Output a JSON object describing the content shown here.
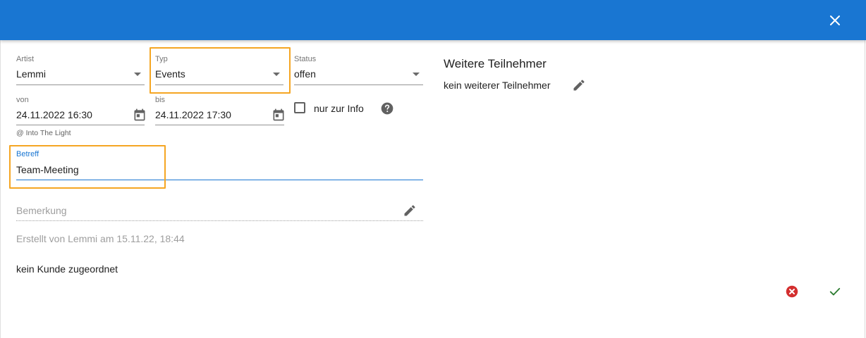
{
  "form": {
    "artist": {
      "label": "Artist",
      "value": "Lemmi"
    },
    "typ": {
      "label": "Typ",
      "value": "Events"
    },
    "status": {
      "label": "Status",
      "value": "offen"
    },
    "von": {
      "label": "von",
      "value": "24.11.2022 16:30"
    },
    "bis": {
      "label": "bis",
      "value": "24.11.2022 17:30"
    },
    "location_hint": "@ Into The Light",
    "info_checkbox": {
      "label": "nur zur Info",
      "checked": false
    },
    "betreff": {
      "label": "Betreff",
      "value": "Team-Meeting"
    },
    "bemerkung": {
      "placeholder": "Bemerkung"
    },
    "created_text": "Erstellt von Lemmi am 15.11.22, 18:44",
    "kunde_text": "kein Kunde zugeordnet"
  },
  "participants": {
    "title": "Weitere Teilnehmer",
    "empty_text": "kein weiterer Teilnehmer"
  },
  "colors": {
    "header": "#1976d2",
    "accent": "#1976d2",
    "highlight": "#f5a623",
    "cancel": "#d32f2f",
    "confirm": "#2e7d32"
  },
  "icons": {
    "close": "close-icon",
    "dropdown": "chevron-down-icon",
    "calendar": "calendar-icon",
    "help": "help-circle-icon",
    "edit": "pencil-icon",
    "cancel": "cancel-circle-icon",
    "confirm": "check-icon"
  }
}
